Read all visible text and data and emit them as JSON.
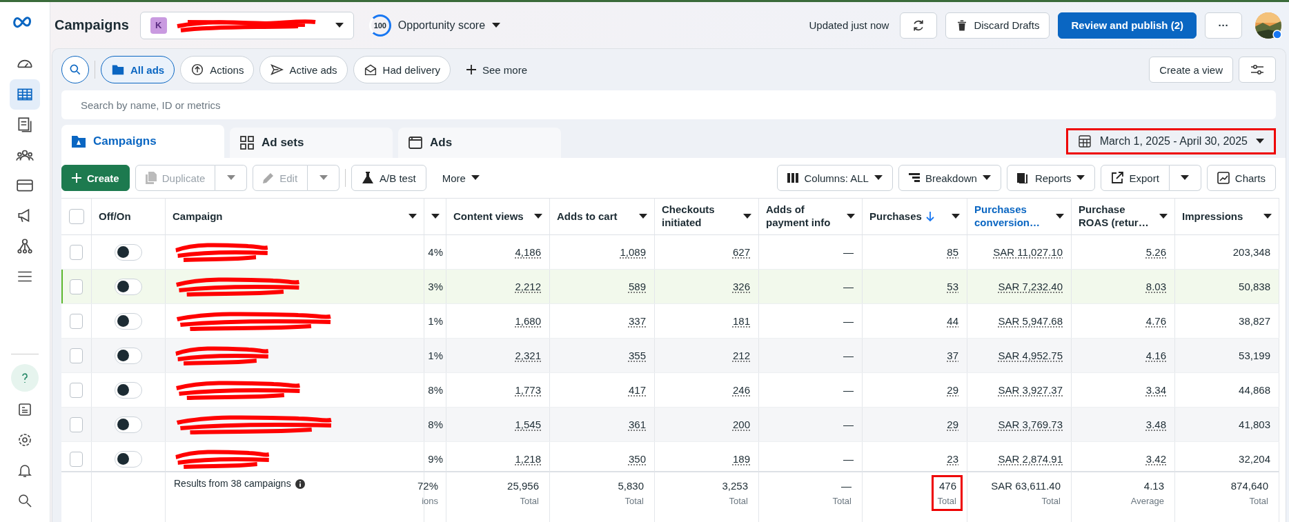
{
  "sidebar": {
    "items": [
      {
        "selected": false
      },
      {
        "selected": true
      },
      {
        "selected": false
      },
      {
        "selected": false
      },
      {
        "selected": false
      },
      {
        "selected": false
      },
      {
        "selected": false
      },
      {
        "selected": false
      }
    ],
    "bottom_items": [
      {
        "selected": true
      },
      {
        "selected": false
      },
      {
        "selected": false
      },
      {
        "selected": false
      },
      {
        "selected": false
      }
    ]
  },
  "header": {
    "title": "Campaigns",
    "account": {
      "badge": "K"
    },
    "opportunity": {
      "score": "100",
      "label": "Opportunity score"
    },
    "updated": "Updated just now",
    "discard": "Discard Drafts",
    "publish": "Review and publish (2)",
    "more": "···"
  },
  "filters": {
    "chips": [
      {
        "label": "All ads",
        "selected": true
      },
      {
        "label": "Actions",
        "selected": false
      },
      {
        "label": "Active ads",
        "selected": false
      },
      {
        "label": "Had delivery",
        "selected": false
      }
    ],
    "see_more": "See more",
    "create_view": "Create a view"
  },
  "search": {
    "placeholder": "Search by name, ID or metrics"
  },
  "tabs": [
    {
      "label": "Campaigns",
      "selected": true
    },
    {
      "label": "Ad sets",
      "selected": false
    },
    {
      "label": "Ads",
      "selected": false
    }
  ],
  "date_range": {
    "label": "March 1, 2025 - April 30, 2025",
    "boxed": true
  },
  "toolbar": {
    "create": "Create",
    "duplicate": {
      "label": "Duplicate",
      "disabled": true
    },
    "edit": {
      "label": "Edit",
      "disabled": true
    },
    "ab_test": "A/B test",
    "more": "More",
    "columns": "Columns: ALL",
    "breakdown": "Breakdown",
    "reports": "Reports",
    "export": "Export",
    "charts": "Charts"
  },
  "table": {
    "columns": [
      {
        "kind": "checkbox",
        "checked": false
      },
      {
        "kind": "toggle",
        "label": "Off/On"
      },
      {
        "kind": "name",
        "label": "Campaign",
        "menu": true
      },
      {
        "kind": "metric",
        "menu": true,
        "dotted": false
      },
      {
        "kind": "metric",
        "label": "Content views",
        "menu": true,
        "dotted": true
      },
      {
        "kind": "metric",
        "label": "Adds to cart",
        "menu": true,
        "dotted": true
      },
      {
        "kind": "metric",
        "label": "Checkouts initiated",
        "menu": true,
        "dotted": true
      },
      {
        "kind": "metric",
        "label": "Adds of payment info",
        "menu": true,
        "dotted": false
      },
      {
        "kind": "metric",
        "label": "Purchases",
        "menu": true,
        "sorted": true,
        "dotted": true
      },
      {
        "kind": "metric",
        "label": "Purchases conversion…",
        "menu": true,
        "active": true,
        "dotted": true
      },
      {
        "kind": "metric",
        "label": "Purchase ROAS (retur…",
        "menu": true,
        "dotted": true
      },
      {
        "kind": "metric",
        "label": "Impressions",
        "menu": true,
        "dotted": false
      }
    ],
    "rows": [
      {
        "highlighted": false,
        "checked": false,
        "on": false,
        "cells": [
          "4%",
          "4,186",
          "1,089",
          "627",
          "—",
          "85",
          "SAR 11,027.10",
          "5.26",
          "203,348"
        ]
      },
      {
        "highlighted": true,
        "checked": false,
        "on": false,
        "cells": [
          "3%",
          "2,212",
          "589",
          "326",
          "—",
          "53",
          "SAR 7,232.40",
          "8.03",
          "50,838"
        ]
      },
      {
        "highlighted": false,
        "checked": false,
        "on": false,
        "cells": [
          "1%",
          "1,680",
          "337",
          "181",
          "—",
          "44",
          "SAR 5,947.68",
          "4.76",
          "38,827"
        ]
      },
      {
        "highlighted": false,
        "checked": false,
        "on": false,
        "cells": [
          "1%",
          "2,321",
          "355",
          "212",
          "—",
          "37",
          "SAR 4,952.75",
          "4.16",
          "53,199"
        ]
      },
      {
        "highlighted": false,
        "checked": false,
        "on": false,
        "cells": [
          "8%",
          "1,773",
          "417",
          "246",
          "—",
          "29",
          "SAR 3,927.37",
          "3.34",
          "44,868"
        ]
      },
      {
        "highlighted": false,
        "checked": false,
        "on": false,
        "cells": [
          "8%",
          "1,545",
          "361",
          "200",
          "—",
          "29",
          "SAR 3,769.73",
          "3.48",
          "41,803"
        ]
      },
      {
        "highlighted": false,
        "checked": false,
        "on": false,
        "cells": [
          "9%",
          "1,218",
          "350",
          "189",
          "—",
          "23",
          "SAR 2,874.91",
          "3.42",
          "32,204"
        ]
      }
    ],
    "footer": {
      "label": "Results from 38 campaigns",
      "totals": [
        {
          "value": "72%",
          "note": "ions",
          "boxed": false
        },
        {
          "value": "25,956",
          "note": "Total",
          "boxed": false
        },
        {
          "value": "5,830",
          "note": "Total",
          "boxed": false
        },
        {
          "value": "3,253",
          "note": "Total",
          "boxed": false
        },
        {
          "value": "—",
          "note": "Total",
          "boxed": false
        },
        {
          "value": "476",
          "note": "Total",
          "boxed": true
        },
        {
          "value": "SAR 63,611.40",
          "note": "Total",
          "boxed": false
        },
        {
          "value": "4.13",
          "note": "Average",
          "boxed": false
        },
        {
          "value": "874,640",
          "note": "Total",
          "boxed": false
        }
      ]
    }
  }
}
